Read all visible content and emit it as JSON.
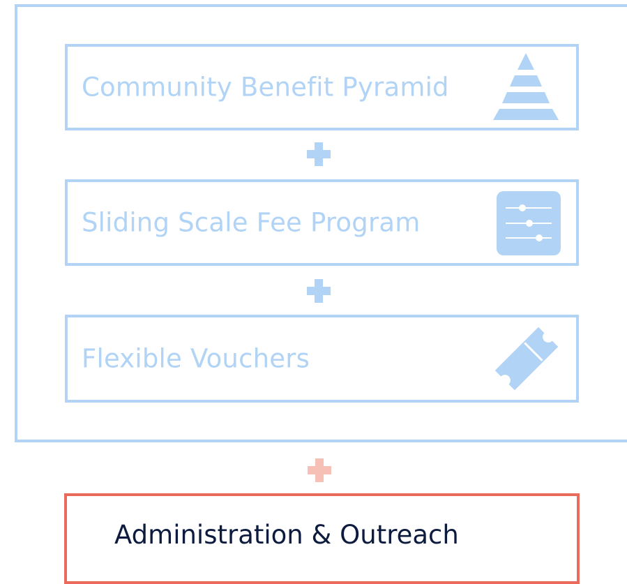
{
  "colors": {
    "program_blue": "#b0d3f6",
    "admin_red": "#e96b5c",
    "admin_plus": "#f7c0b6",
    "admin_text": "#0d1b3e"
  },
  "programs": [
    {
      "label": "Community Benefit Pyramid",
      "icon": "pyramid-icon"
    },
    {
      "label": "Sliding Scale Fee Program",
      "icon": "sliders-icon"
    },
    {
      "label": "Flexible Vouchers",
      "icon": "ticket-icon"
    }
  ],
  "administration": {
    "label": "Administration & Outreach"
  }
}
